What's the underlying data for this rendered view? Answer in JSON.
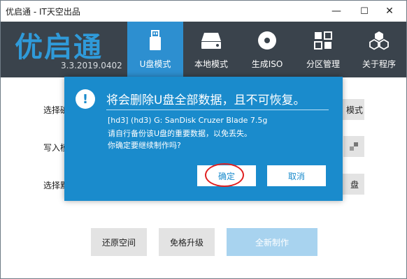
{
  "window": {
    "title": "优启通 - IT天空出品",
    "minimize": "—",
    "maximize": "☐",
    "close": "✕"
  },
  "header": {
    "logo": "优启通",
    "version": "3.3.2019.0402",
    "tabs": [
      {
        "label": "U盘模式",
        "icon": "usb-drive-icon",
        "active": true
      },
      {
        "label": "本地模式",
        "icon": "hard-disk-icon",
        "active": false
      },
      {
        "label": "生成ISO",
        "icon": "disc-icon",
        "active": false
      },
      {
        "label": "分区管理",
        "icon": "grid-icon",
        "active": false
      },
      {
        "label": "关于程序",
        "icon": "cubes-icon",
        "active": false
      }
    ]
  },
  "main": {
    "labels": [
      "选择磁",
      "写入模",
      "选择默"
    ],
    "side_buttons": [
      "模式",
      "",
      "盘"
    ],
    "bottom_buttons": {
      "restore": "还原空间",
      "upgrade": "免格升级",
      "create": "全新制作"
    }
  },
  "dialog": {
    "icon": "!",
    "title": "将会删除U盘全部数据，且不可恢复。",
    "device": "[hd3] (hd3) G: SanDisk Cruzer Blade 7.5g",
    "backup_hint": "请自行备份该U盘的重要数据，以免丢失。",
    "confirm_question": "你确定要继续制作吗?",
    "ok_label": "确定",
    "cancel_label": "取消"
  },
  "colors": {
    "accent": "#1a8bcc",
    "header_bg": "#3a434c",
    "active_tab": "#2d8fd0",
    "highlight": "#e02020"
  }
}
